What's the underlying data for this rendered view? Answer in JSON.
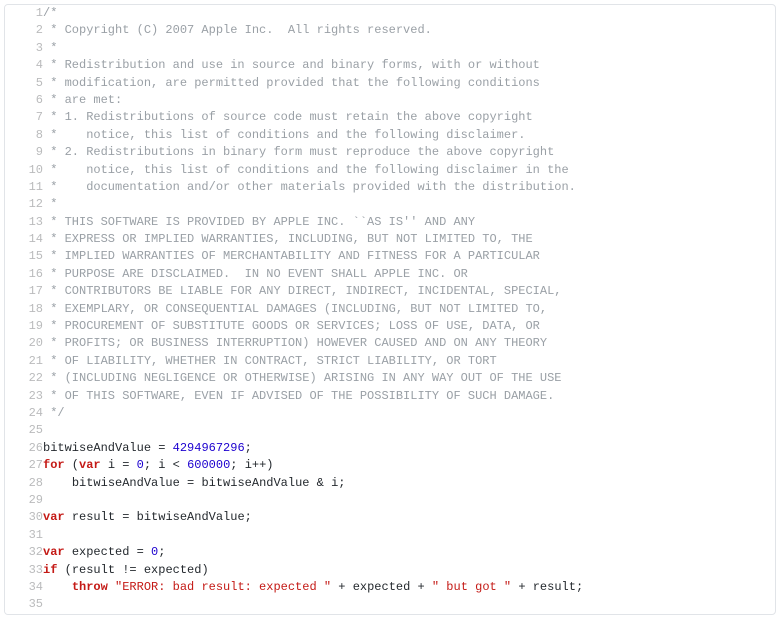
{
  "code": {
    "lines": [
      {
        "n": 1,
        "segs": [
          {
            "c": "c",
            "t": "/*"
          }
        ]
      },
      {
        "n": 2,
        "segs": [
          {
            "c": "c",
            "t": " * Copyright (C) 2007 Apple Inc.  All rights reserved."
          }
        ]
      },
      {
        "n": 3,
        "segs": [
          {
            "c": "c",
            "t": " *"
          }
        ]
      },
      {
        "n": 4,
        "segs": [
          {
            "c": "c",
            "t": " * Redistribution and use in source and binary forms, with or without"
          }
        ]
      },
      {
        "n": 5,
        "segs": [
          {
            "c": "c",
            "t": " * modification, are permitted provided that the following conditions"
          }
        ]
      },
      {
        "n": 6,
        "segs": [
          {
            "c": "c",
            "t": " * are met:"
          }
        ]
      },
      {
        "n": 7,
        "segs": [
          {
            "c": "c",
            "t": " * 1. Redistributions of source code must retain the above copyright"
          }
        ]
      },
      {
        "n": 8,
        "segs": [
          {
            "c": "c",
            "t": " *    notice, this list of conditions and the following disclaimer."
          }
        ]
      },
      {
        "n": 9,
        "segs": [
          {
            "c": "c",
            "t": " * 2. Redistributions in binary form must reproduce the above copyright"
          }
        ]
      },
      {
        "n": 10,
        "segs": [
          {
            "c": "c",
            "t": " *    notice, this list of conditions and the following disclaimer in the"
          }
        ]
      },
      {
        "n": 11,
        "segs": [
          {
            "c": "c",
            "t": " *    documentation and/or other materials provided with the distribution."
          }
        ]
      },
      {
        "n": 12,
        "segs": [
          {
            "c": "c",
            "t": " *"
          }
        ]
      },
      {
        "n": 13,
        "segs": [
          {
            "c": "c",
            "t": " * THIS SOFTWARE IS PROVIDED BY APPLE INC. ``AS IS'' AND ANY"
          }
        ]
      },
      {
        "n": 14,
        "segs": [
          {
            "c": "c",
            "t": " * EXPRESS OR IMPLIED WARRANTIES, INCLUDING, BUT NOT LIMITED TO, THE"
          }
        ]
      },
      {
        "n": 15,
        "segs": [
          {
            "c": "c",
            "t": " * IMPLIED WARRANTIES OF MERCHANTABILITY AND FITNESS FOR A PARTICULAR"
          }
        ]
      },
      {
        "n": 16,
        "segs": [
          {
            "c": "c",
            "t": " * PURPOSE ARE DISCLAIMED.  IN NO EVENT SHALL APPLE INC. OR"
          }
        ]
      },
      {
        "n": 17,
        "segs": [
          {
            "c": "c",
            "t": " * CONTRIBUTORS BE LIABLE FOR ANY DIRECT, INDIRECT, INCIDENTAL, SPECIAL,"
          }
        ]
      },
      {
        "n": 18,
        "segs": [
          {
            "c": "c",
            "t": " * EXEMPLARY, OR CONSEQUENTIAL DAMAGES (INCLUDING, BUT NOT LIMITED TO,"
          }
        ]
      },
      {
        "n": 19,
        "segs": [
          {
            "c": "c",
            "t": " * PROCUREMENT OF SUBSTITUTE GOODS OR SERVICES; LOSS OF USE, DATA, OR"
          }
        ]
      },
      {
        "n": 20,
        "segs": [
          {
            "c": "c",
            "t": " * PROFITS; OR BUSINESS INTERRUPTION) HOWEVER CAUSED AND ON ANY THEORY"
          }
        ]
      },
      {
        "n": 21,
        "segs": [
          {
            "c": "c",
            "t": " * OF LIABILITY, WHETHER IN CONTRACT, STRICT LIABILITY, OR TORT"
          }
        ]
      },
      {
        "n": 22,
        "segs": [
          {
            "c": "c",
            "t": " * (INCLUDING NEGLIGENCE OR OTHERWISE) ARISING IN ANY WAY OUT OF THE USE"
          }
        ]
      },
      {
        "n": 23,
        "segs": [
          {
            "c": "c",
            "t": " * OF THIS SOFTWARE, EVEN IF ADVISED OF THE POSSIBILITY OF SUCH DAMAGE."
          }
        ]
      },
      {
        "n": 24,
        "segs": [
          {
            "c": "c",
            "t": " */"
          }
        ]
      },
      {
        "n": 25,
        "segs": [
          {
            "c": "id",
            "t": ""
          }
        ]
      },
      {
        "n": 26,
        "segs": [
          {
            "c": "id",
            "t": "bitwiseAndValue"
          },
          {
            "c": "op",
            "t": " = "
          },
          {
            "c": "num",
            "t": "4294967296"
          },
          {
            "c": "op",
            "t": ";"
          }
        ]
      },
      {
        "n": 27,
        "segs": [
          {
            "c": "kw",
            "t": "for"
          },
          {
            "c": "op",
            "t": " ("
          },
          {
            "c": "kw",
            "t": "var"
          },
          {
            "c": "op",
            "t": " "
          },
          {
            "c": "id",
            "t": "i"
          },
          {
            "c": "op",
            "t": " = "
          },
          {
            "c": "num",
            "t": "0"
          },
          {
            "c": "op",
            "t": "; "
          },
          {
            "c": "id",
            "t": "i"
          },
          {
            "c": "op",
            "t": " < "
          },
          {
            "c": "num",
            "t": "600000"
          },
          {
            "c": "op",
            "t": "; "
          },
          {
            "c": "id",
            "t": "i"
          },
          {
            "c": "op",
            "t": "++)"
          }
        ]
      },
      {
        "n": 28,
        "segs": [
          {
            "c": "op",
            "t": "    "
          },
          {
            "c": "id",
            "t": "bitwiseAndValue"
          },
          {
            "c": "op",
            "t": " = "
          },
          {
            "c": "id",
            "t": "bitwiseAndValue"
          },
          {
            "c": "op",
            "t": " & "
          },
          {
            "c": "id",
            "t": "i"
          },
          {
            "c": "op",
            "t": ";"
          }
        ]
      },
      {
        "n": 29,
        "segs": [
          {
            "c": "id",
            "t": ""
          }
        ]
      },
      {
        "n": 30,
        "segs": [
          {
            "c": "kw",
            "t": "var"
          },
          {
            "c": "op",
            "t": " "
          },
          {
            "c": "id",
            "t": "result"
          },
          {
            "c": "op",
            "t": " = "
          },
          {
            "c": "id",
            "t": "bitwiseAndValue"
          },
          {
            "c": "op",
            "t": ";"
          }
        ]
      },
      {
        "n": 31,
        "segs": [
          {
            "c": "id",
            "t": ""
          }
        ]
      },
      {
        "n": 32,
        "segs": [
          {
            "c": "kw",
            "t": "var"
          },
          {
            "c": "op",
            "t": " "
          },
          {
            "c": "id",
            "t": "expected"
          },
          {
            "c": "op",
            "t": " = "
          },
          {
            "c": "num",
            "t": "0"
          },
          {
            "c": "op",
            "t": ";"
          }
        ]
      },
      {
        "n": 33,
        "segs": [
          {
            "c": "kw",
            "t": "if"
          },
          {
            "c": "op",
            "t": " ("
          },
          {
            "c": "id",
            "t": "result"
          },
          {
            "c": "op",
            "t": " != "
          },
          {
            "c": "id",
            "t": "expected"
          },
          {
            "c": "op",
            "t": ")"
          }
        ]
      },
      {
        "n": 34,
        "segs": [
          {
            "c": "op",
            "t": "    "
          },
          {
            "c": "kw",
            "t": "throw"
          },
          {
            "c": "op",
            "t": " "
          },
          {
            "c": "str",
            "t": "\"ERROR: bad result: expected \""
          },
          {
            "c": "op",
            "t": " + "
          },
          {
            "c": "id",
            "t": "expected"
          },
          {
            "c": "op",
            "t": " + "
          },
          {
            "c": "str",
            "t": "\" but got \""
          },
          {
            "c": "op",
            "t": " + "
          },
          {
            "c": "id",
            "t": "result"
          },
          {
            "c": "op",
            "t": ";"
          }
        ]
      },
      {
        "n": 35,
        "segs": [
          {
            "c": "id",
            "t": ""
          }
        ]
      }
    ]
  }
}
